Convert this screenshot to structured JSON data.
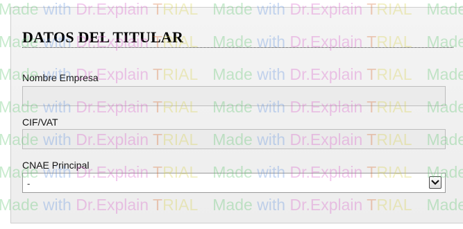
{
  "section": {
    "title": "DATOS DEL TITULAR"
  },
  "fields": {
    "company_name": {
      "label": "Nombre Empresa",
      "value": ""
    },
    "cif_vat": {
      "label": "CIF/VAT",
      "value": ""
    },
    "cnae": {
      "label": "CNAE Principal",
      "selected": "-"
    }
  },
  "watermark": {
    "made": "Made",
    "with": "with",
    "brand": "Dr.Explain",
    "trial_t": "T",
    "trial_rest": "RIAL"
  },
  "icons": {
    "dropdown": "chevron-down-icon"
  }
}
